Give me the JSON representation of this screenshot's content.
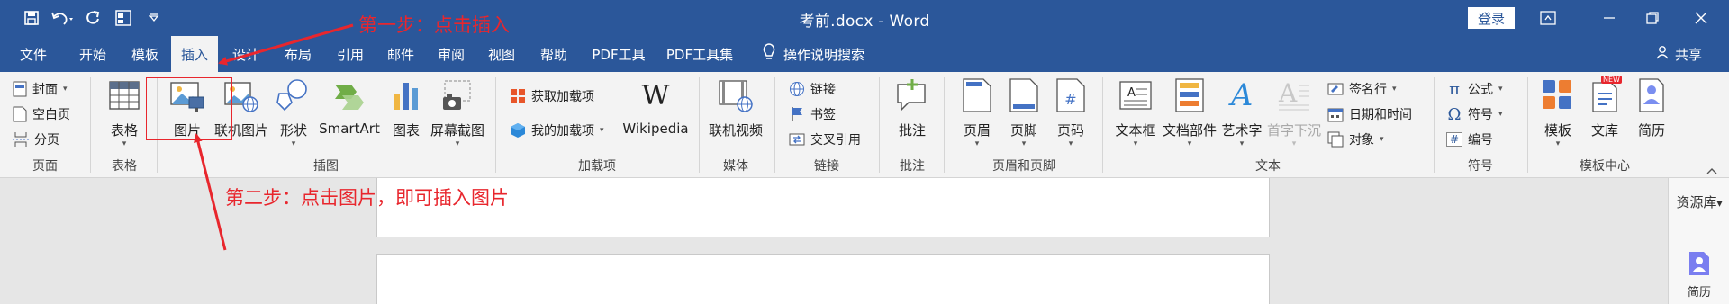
{
  "titlebar": {
    "title": "考前.docx  -  Word",
    "login": "登录",
    "accent": "#2b579a"
  },
  "tabs": [
    {
      "label": "文件"
    },
    {
      "label": "开始"
    },
    {
      "label": "模板"
    },
    {
      "label": "插入",
      "active": true
    },
    {
      "label": "设计"
    },
    {
      "label": "布局"
    },
    {
      "label": "引用"
    },
    {
      "label": "邮件"
    },
    {
      "label": "审阅"
    },
    {
      "label": "视图"
    },
    {
      "label": "帮助"
    },
    {
      "label": "PDF工具"
    },
    {
      "label": "PDF工具集"
    }
  ],
  "tellme": {
    "label": "操作说明搜索",
    "icon": "lightbulb-icon"
  },
  "share": {
    "label": "共享",
    "icon": "person-icon"
  },
  "ribbon": {
    "pages": {
      "cover": "封面",
      "blank": "空白页",
      "break": "分页",
      "group": "页面"
    },
    "table": {
      "label": "表格",
      "group": "表格"
    },
    "illustrations": {
      "group": "插图",
      "picture": "图片",
      "online_picture": "联机图片",
      "shapes": "形状",
      "smartart": "SmartArt",
      "chart": "图表",
      "screenshot": "屏幕截图"
    },
    "addins": {
      "get": "获取加载项",
      "mine": "我的加载项",
      "wikipedia": "Wikipedia",
      "group": "加载项"
    },
    "media": {
      "online_video": "联机视频",
      "group": "媒体"
    },
    "links": {
      "link": "链接",
      "bookmark": "书签",
      "cross_ref": "交叉引用",
      "group": "链接"
    },
    "comments": {
      "comment": "批注",
      "group": "批注"
    },
    "header_footer": {
      "header": "页眉",
      "footer": "页脚",
      "page_number": "页码",
      "group": "页眉和页脚"
    },
    "text": {
      "textbox": "文本框",
      "quick_parts": "文档部件",
      "wordart": "艺术字",
      "dropcap": "首字下沉",
      "signature": "签名行",
      "datetime": "日期和时间",
      "object": "对象",
      "group": "文本"
    },
    "symbols": {
      "equation": "公式",
      "symbol": "符号",
      "number": "编号",
      "group": "符号"
    },
    "template_center": {
      "template": "模板",
      "library": "文库",
      "resume": "简历",
      "new_badge": "NEW",
      "group": "模板中心"
    }
  },
  "sidepanel": {
    "title": "资源库",
    "item": "简历"
  },
  "annotations": {
    "step1": "第一步：点击插入",
    "step2": "第二步：点击图片，即可插入图片",
    "color": "#e8262d"
  }
}
